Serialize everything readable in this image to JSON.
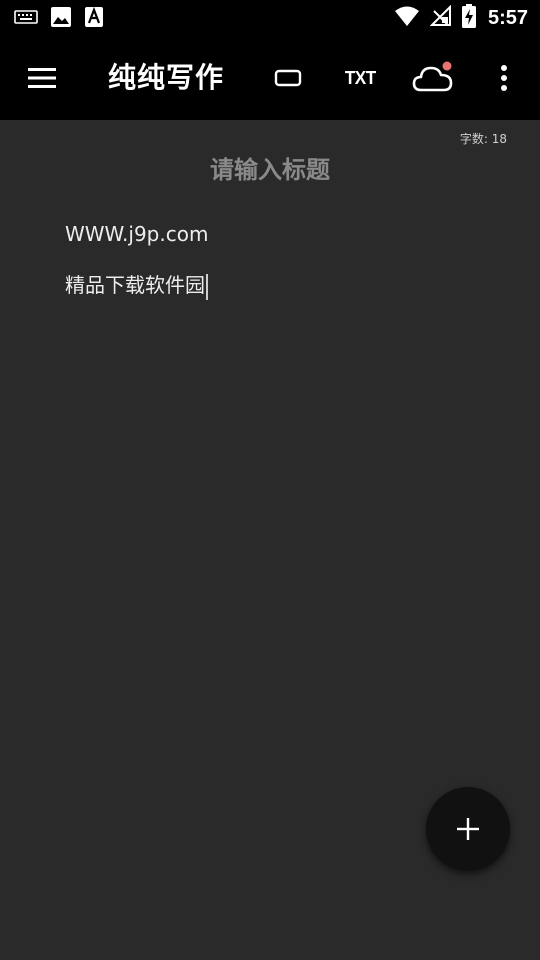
{
  "status_bar": {
    "time": "5:57",
    "icons": [
      "keyboard-icon",
      "image-icon",
      "font-a-icon",
      "wifi-icon",
      "no-signal-icon",
      "battery-charging-icon"
    ]
  },
  "app_bar": {
    "title": "纯纯写作",
    "txt_label": "TXT",
    "icons": [
      "menu-icon",
      "fullscreen-icon",
      "txt-icon",
      "cloud-sync-icon",
      "more-vertical-icon"
    ],
    "cloud_badge_color": "#e57373"
  },
  "editor": {
    "word_count_label": "字数: 18",
    "title_placeholder": "请输入标题",
    "lines": [
      "WWW.j9p.com",
      "精品下载软件园"
    ]
  },
  "fab": {
    "icon": "plus-icon"
  },
  "colors": {
    "bar_bg": "#000000",
    "editor_bg": "#2a2a2a",
    "text": "#ededed",
    "placeholder": "#8a8a8a"
  }
}
